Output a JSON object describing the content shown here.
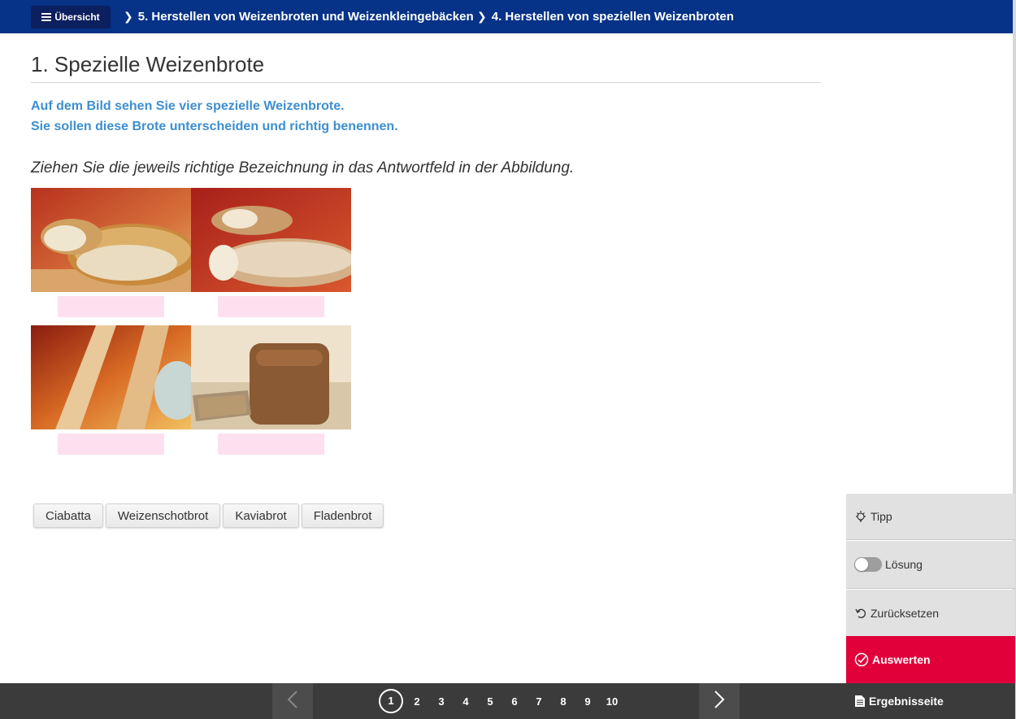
{
  "header": {
    "overview_label": "Übersicht",
    "breadcrumbs": [
      "5. Herstellen von Weizenbroten und Weizenkleingebäcken",
      "4. Herstellen von speziellen Weizenbroten"
    ]
  },
  "main": {
    "title": "1. Spezielle Weizenbrote",
    "intro_lines": [
      "Auf dem Bild sehen Sie vier spezielle Weizenbrote.",
      "Sie sollen diese Brote unterscheiden und richtig benennen."
    ],
    "task": "Ziehen Sie die jeweils richtige Bezeichnung in das Antwortfeld in der Abbildung.",
    "drop_fields": [
      "",
      "",
      "",
      ""
    ],
    "word_options": [
      "Ciabatta",
      "Weizenschotbrot",
      "Kaviabrot",
      "Fladenbrot"
    ]
  },
  "side_panel": {
    "tipp": "Tipp",
    "loesung": "Lösung",
    "loesung_on": false,
    "reset": "Zurücksetzen",
    "evaluate": "Auswerten",
    "results": "Ergebnisseite"
  },
  "pagination": {
    "current": 1,
    "pages": [
      "1",
      "2",
      "3",
      "4",
      "5",
      "6",
      "7",
      "8",
      "9",
      "10"
    ]
  },
  "colors": {
    "header_bg": "#063287",
    "accent_blue": "#3d8fd0",
    "evaluate_red": "#e2003b",
    "drop_pink": "#fde0ef",
    "footer_bg": "#3b3b3b"
  }
}
